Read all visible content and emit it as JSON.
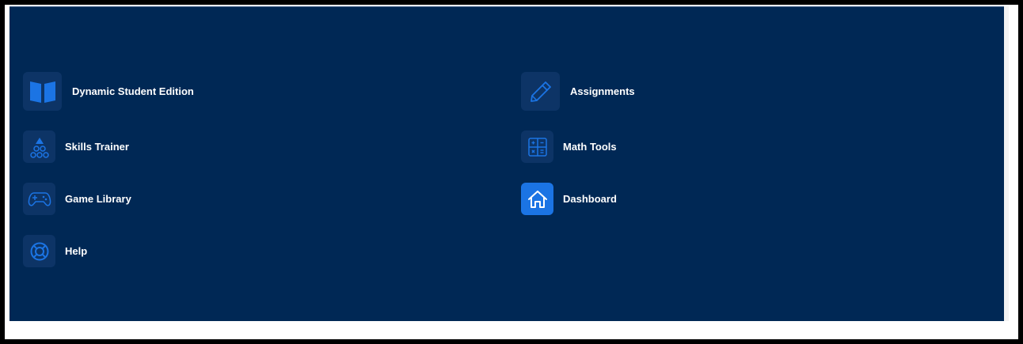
{
  "menu": {
    "items": [
      {
        "label": "Dynamic Student Edition",
        "icon": "book-icon"
      },
      {
        "label": "Assignments",
        "icon": "pencil-icon"
      },
      {
        "label": "Skills Trainer",
        "icon": "skills-blocks-icon"
      },
      {
        "label": "Math Tools",
        "icon": "calculator-icon"
      },
      {
        "label": "Game Library",
        "icon": "gamepad-icon"
      },
      {
        "label": "Dashboard",
        "icon": "home-icon",
        "active": true
      },
      {
        "label": "Help",
        "icon": "lifebuoy-icon"
      }
    ]
  },
  "colors": {
    "panel_background": "#002855",
    "icon_background": "#0d3466",
    "icon_blue": "#1b74e4",
    "active_icon_background": "#1b74e4",
    "text": "#ffffff"
  }
}
